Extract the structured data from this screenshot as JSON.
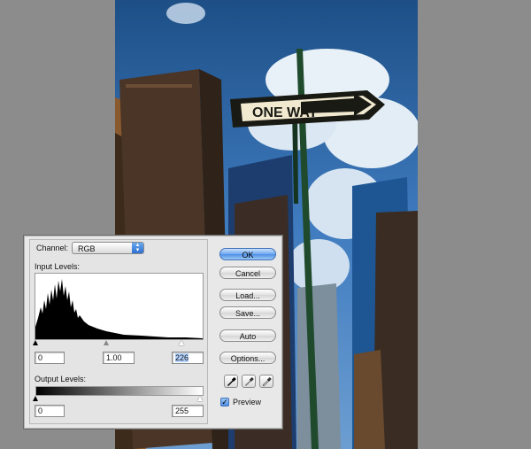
{
  "photo": {
    "sign_text": "ONE WAY"
  },
  "dialog": {
    "channel_label": "Channel:",
    "channel_value": "RGB",
    "input_levels_label": "Input Levels:",
    "input_black": "0",
    "input_gamma": "1.00",
    "input_white": "226",
    "output_levels_label": "Output Levels:",
    "output_black": "0",
    "output_white": "255",
    "buttons": {
      "ok": "OK",
      "cancel": "Cancel",
      "load": "Load...",
      "save": "Save...",
      "auto": "Auto",
      "options": "Options..."
    },
    "preview_label": "Preview",
    "preview_checked": true,
    "input_black_fraction": 0.0,
    "input_gamma_fraction": 0.43,
    "input_white_fraction": 0.886,
    "output_black_fraction": 0.0,
    "output_white_fraction": 1.0
  }
}
